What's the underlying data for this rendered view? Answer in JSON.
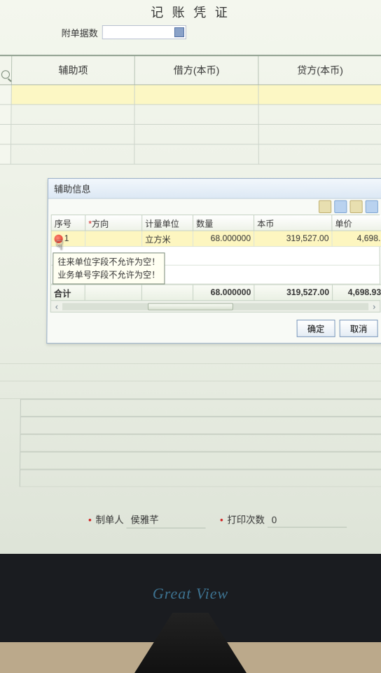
{
  "window_title": "记 账 凭 证",
  "top_form": {
    "attachments_label": "附单据数"
  },
  "main_columns": {
    "aux_item": "辅助项",
    "debit": "借方(本币)",
    "credit": "贷方(本币)"
  },
  "aux_panel": {
    "title": "辅助信息",
    "columns": {
      "seq": "序号",
      "direction": "方向",
      "direction_required": "*",
      "unit": "计量单位",
      "qty": "数量",
      "base_currency": "本币",
      "price": "单价"
    },
    "rows": [
      {
        "seq": "1",
        "direction": "",
        "unit": "立方米",
        "qty": "68.000000",
        "base_currency": "319,527.00",
        "price": "4,698."
      }
    ],
    "total": {
      "label": "合计",
      "qty": "68.000000",
      "base_currency": "319,527.00",
      "price": "4,698.93"
    },
    "tooltip_line1": "往来单位字段不允许为空！",
    "tooltip_line2": "业务单号字段不允许为空！",
    "buttons": {
      "ok": "确定",
      "cancel": "取消"
    }
  },
  "footer": {
    "preparer_label": "制单人",
    "preparer_value": "侯雅芊",
    "print_count_label": "打印次数",
    "print_count_value": "0"
  },
  "monitor_brand": "Great View"
}
